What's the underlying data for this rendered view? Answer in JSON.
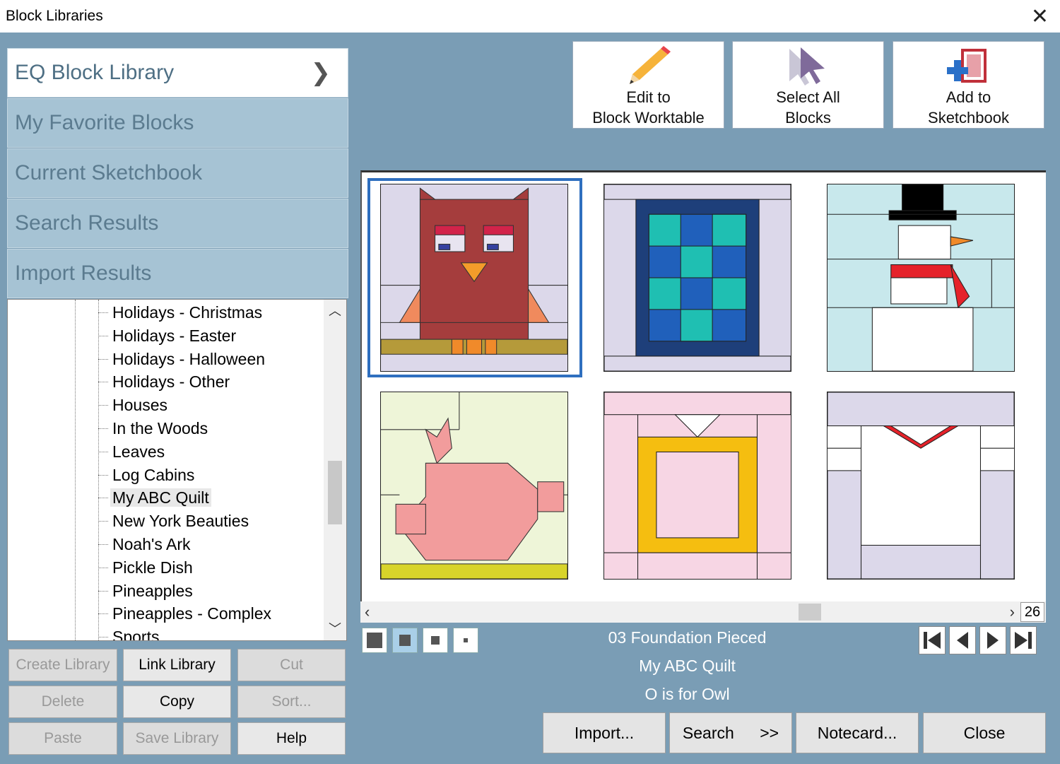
{
  "window": {
    "title": "Block Libraries",
    "close_glyph": "✕"
  },
  "libraries": [
    {
      "label": "EQ Block Library",
      "active": true
    },
    {
      "label": "My Favorite Blocks"
    },
    {
      "label": "Current Sketchbook"
    },
    {
      "label": "Search Results"
    },
    {
      "label": "Import Results"
    }
  ],
  "tree": {
    "items": [
      "Holidays - Christmas",
      "Holidays - Easter",
      "Holidays - Halloween",
      "Holidays - Other",
      "Houses",
      "In the Woods",
      "Leaves",
      "Log Cabins",
      "My ABC Quilt",
      "New York Beauties",
      "Noah's Ark",
      "Pickle Dish",
      "Pineapples",
      "Pineapples - Complex",
      "Sports"
    ],
    "selected": "My ABC Quilt"
  },
  "left_buttons": {
    "create_library": "Create Library",
    "link_library": "Link Library",
    "cut": "Cut",
    "delete": "Delete",
    "copy": "Copy",
    "sort": "Sort...",
    "paste": "Paste",
    "save_library": "Save Library",
    "help": "Help"
  },
  "toolbar": {
    "edit": {
      "line1": "Edit to",
      "line2": "Block Worktable",
      "icon": "pencil-icon"
    },
    "select_all": {
      "line1": "Select All",
      "line2": "Blocks",
      "icon": "cursor-icon"
    },
    "add_sketchbook": {
      "line1": "Add to",
      "line2": "Sketchbook",
      "icon": "sketchbook-add-icon"
    }
  },
  "grid": {
    "count": "26",
    "colors": {
      "selection": "#2f6fbf"
    }
  },
  "info": {
    "category": "03 Foundation Pieced",
    "library": "My ABC Quilt",
    "block": "O is for Owl"
  },
  "bottom_buttons": {
    "import": "Import...",
    "search": "Search",
    "search_arrow": ">>",
    "notecard": "Notecard...",
    "close": "Close"
  }
}
